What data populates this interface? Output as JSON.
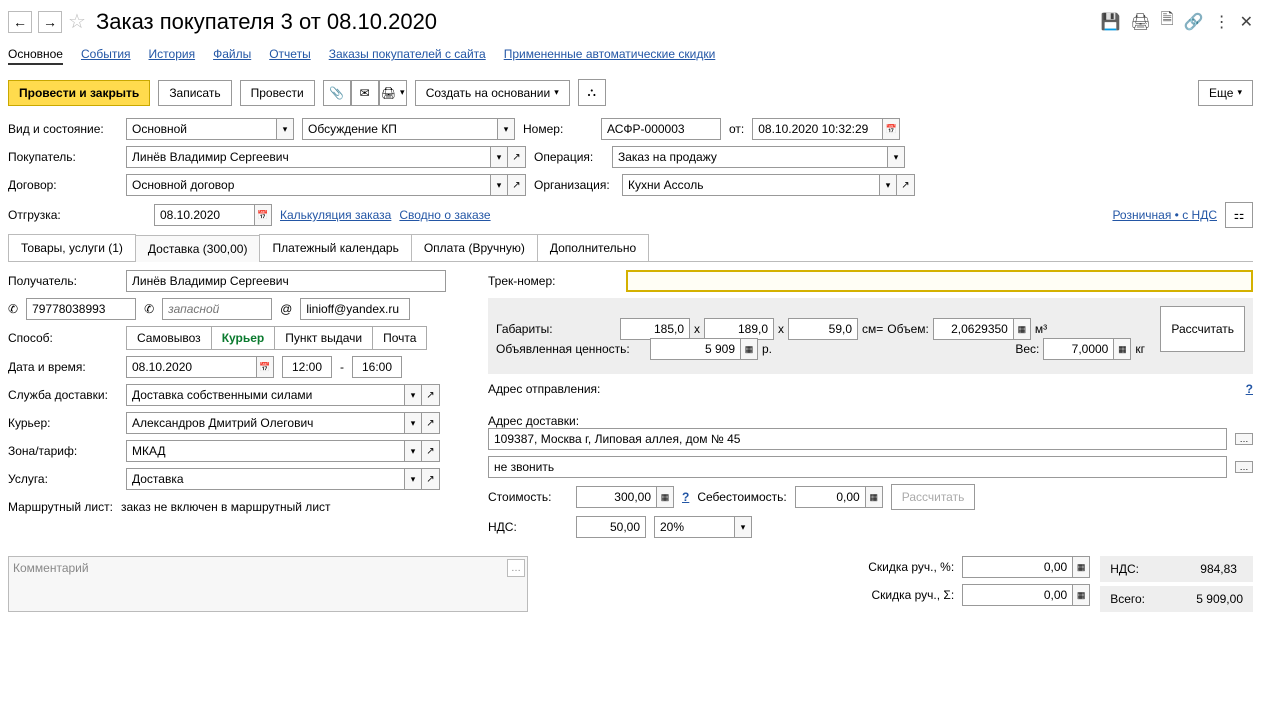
{
  "title": "Заказ покупателя 3 от 08.10.2020",
  "linktabs": [
    "Основное",
    "События",
    "История",
    "Файлы",
    "Отчеты",
    "Заказы покупателей с сайта",
    "Примененные автоматические скидки"
  ],
  "toolbar": {
    "post_close": "Провести и закрыть",
    "write": "Записать",
    "post": "Провести",
    "create_based": "Создать на основании",
    "more": "Еще"
  },
  "header": {
    "kind_state_lbl": "Вид и состояние:",
    "kind": "Основной",
    "state": "Обсуждение КП",
    "number_lbl": "Номер:",
    "number": "АСФР-000003",
    "from_lbl": "от:",
    "date": "08.10.2020 10:32:29",
    "buyer_lbl": "Покупатель:",
    "buyer": "Линёв Владимир Сергеевич",
    "operation_lbl": "Операция:",
    "operation": "Заказ на продажу",
    "contract_lbl": "Договор:",
    "contract": "Основной договор",
    "org_lbl": "Организация:",
    "org": "Кухни Ассоль",
    "ship_lbl": "Отгрузка:",
    "ship_date": "08.10.2020",
    "calc_link": "Калькуляция заказа",
    "summary_link": "Сводно о заказе",
    "price_link": "Розничная • с НДС"
  },
  "tabs": [
    "Товары, услуги (1)",
    "Доставка (300,00)",
    "Платежный календарь",
    "Оплата (Вручную)",
    "Дополнительно"
  ],
  "delivery": {
    "recipient_lbl": "Получатель:",
    "recipient": "Линёв Владимир Сергеевич",
    "phone1": "79778038993",
    "phone2_ph": "запасной",
    "email": "linioff@yandex.ru",
    "method_lbl": "Способ:",
    "methods": [
      "Самовывоз",
      "Курьер",
      "Пункт выдачи",
      "Почта"
    ],
    "method_active": 1,
    "datetime_lbl": "Дата и время:",
    "date": "08.10.2020",
    "time_from": "12:00",
    "time_to": "16:00",
    "service_lbl": "Служба доставки:",
    "service": "Доставка собственными силами",
    "courier_lbl": "Курьер:",
    "courier": "Александров Дмитрий Олегович",
    "zone_lbl": "Зона/тариф:",
    "zone": "МКАД",
    "usluga_lbl": "Услуга:",
    "usluga": "Доставка",
    "route_lbl": "Маршрутный лист:",
    "route_text": "заказ не включен в маршрутный лист"
  },
  "right": {
    "track_lbl": "Трек-номер:",
    "dims_lbl": "Габариты:",
    "dim1": "185,0",
    "dim2": "189,0",
    "dim3": "59,0",
    "dim_unit": "см=",
    "vol_lbl": "Объем:",
    "vol": "2,0629350",
    "vol_unit": "м³",
    "calc_btn": "Рассчитать",
    "declared_lbl": "Объявленная ценность:",
    "declared": "5 909",
    "declared_unit": "р.",
    "weight_lbl": "Вес:",
    "weight": "7,0000",
    "weight_unit": "кг",
    "addr_from_lbl": "Адрес отправления:",
    "addr_to_lbl": "Адрес доставки:",
    "addr_to": "109387, Москва г, Липовая аллея, дом № 45",
    "note": "не звонить",
    "cost_lbl": "Стоимость:",
    "cost": "300,00",
    "selfcost_lbl": "Себестоимость:",
    "selfcost": "0,00",
    "calc2": "Рассчитать",
    "vat_lbl": "НДС:",
    "vat_sum": "50,00",
    "vat_rate": "20%"
  },
  "footer": {
    "comment_ph": "Комментарий",
    "disc_pct_lbl": "Скидка руч., %:",
    "disc_pct": "0,00",
    "disc_sum_lbl": "Скидка руч., Σ:",
    "disc_sum": "0,00",
    "vat_lbl": "НДС:",
    "vat": "984,83",
    "total_lbl": "Всего:",
    "total": "5 909,00"
  }
}
